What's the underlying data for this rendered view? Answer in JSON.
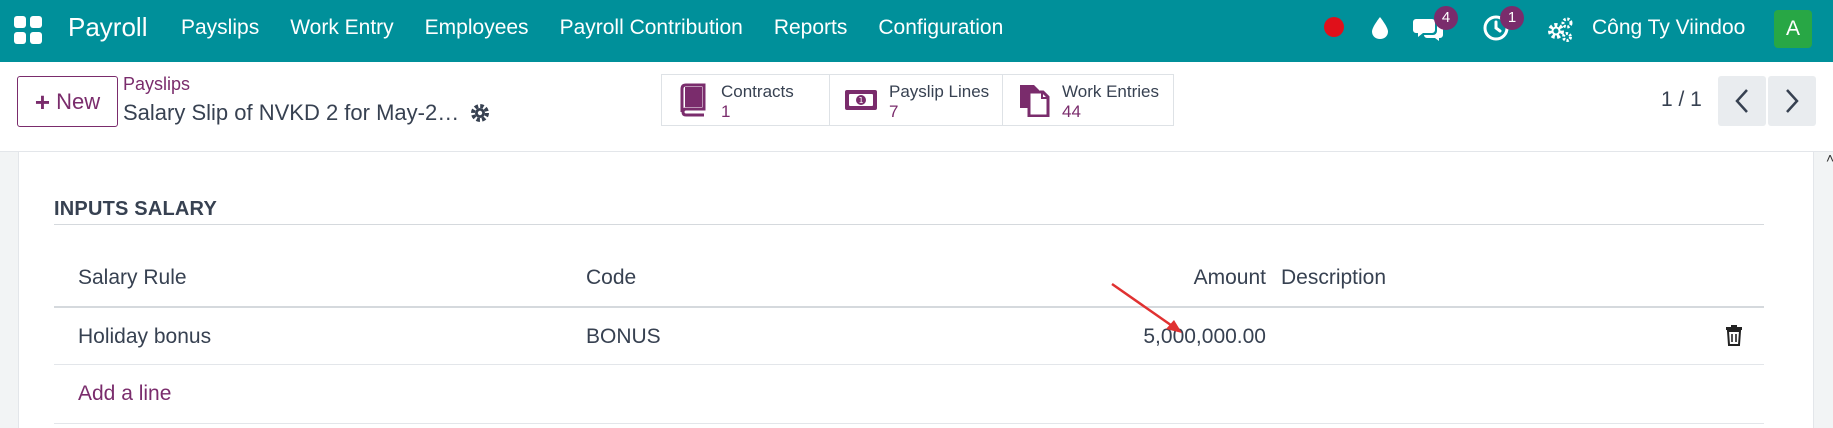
{
  "navbar": {
    "app_title": "Payroll",
    "menu": [
      "Payslips",
      "Work Entry",
      "Employees",
      "Payroll Contribution",
      "Reports",
      "Configuration"
    ],
    "messages_count": "4",
    "activities_count": "1",
    "company": "Công Ty Viindoo",
    "avatar_letter": "A",
    "icons": [
      "apps-icon",
      "record-dot-icon",
      "water-drop-icon",
      "chat-icon",
      "clock-icon",
      "gears-icon"
    ]
  },
  "control_panel": {
    "new_label": "New",
    "breadcrumb": "Payslips",
    "record_title": "Salary Slip of NVKD 2 for May-2…",
    "smart_buttons": [
      {
        "label": "Contracts",
        "value": "1",
        "icon": "book-icon"
      },
      {
        "label": "Payslip Lines",
        "value": "7",
        "icon": "money-icon"
      },
      {
        "label": "Work Entries",
        "value": "44",
        "icon": "files-icon"
      }
    ],
    "pager": "1 / 1"
  },
  "section": {
    "title": "INPUTS SALARY",
    "columns": {
      "rule": "Salary Rule",
      "code": "Code",
      "amount": "Amount",
      "description": "Description"
    },
    "rows": [
      {
        "rule": "Holiday bonus",
        "code": "BONUS",
        "amount": "5,000,000.00",
        "description": ""
      }
    ],
    "add_line": "Add a line"
  },
  "colors": {
    "navbar": "#00909a",
    "accent": "#7a2c6c",
    "badge": "#7a2c6c",
    "avatar": "#28a745",
    "record_dot": "#e0101a",
    "annotation_arrow": "#e03131"
  }
}
